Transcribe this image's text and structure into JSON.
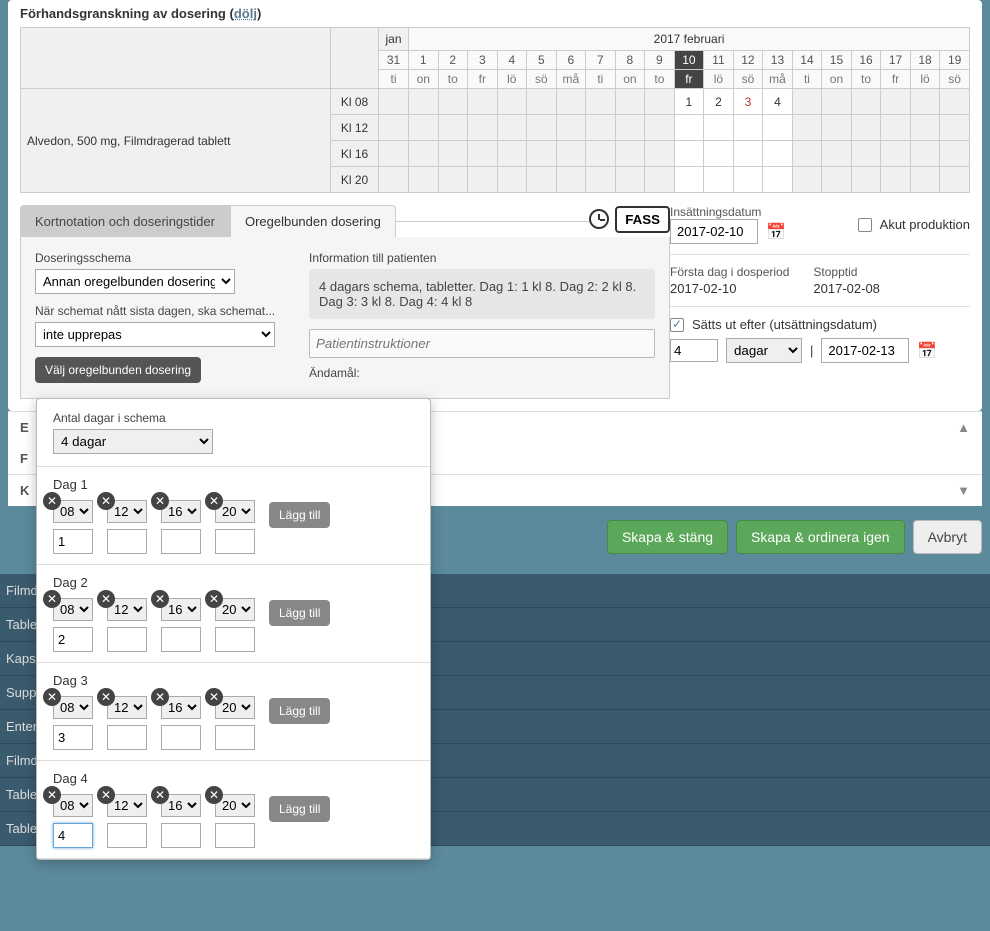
{
  "preview": {
    "title": "Förhandsgranskning av dosering",
    "hide": "dölj"
  },
  "calendar": {
    "jan": "jan",
    "month": "2017 februari",
    "days": [
      "31",
      "1",
      "2",
      "3",
      "4",
      "5",
      "6",
      "7",
      "8",
      "9",
      "10",
      "11",
      "12",
      "13",
      "14",
      "15",
      "16",
      "17",
      "18",
      "19"
    ],
    "wk": [
      "ti",
      "on",
      "to",
      "fr",
      "lö",
      "sö",
      "må",
      "ti",
      "on",
      "to",
      "fr",
      "lö",
      "sö",
      "må",
      "ti",
      "on",
      "to",
      "fr",
      "lö",
      "sö"
    ],
    "today_index": 10,
    "med": "Alvedon, 500 mg, Filmdragerad tablett",
    "times": [
      "Kl 08",
      "Kl 12",
      "Kl 16",
      "Kl 20"
    ],
    "doses08": [
      "1",
      "2",
      "3",
      "4"
    ]
  },
  "tabs": {
    "left": "Kortnotation och doseringstider",
    "right": "Oregelbunden dosering",
    "fass": "FASS"
  },
  "dos": {
    "schema_label": "Doseringsschema",
    "schema_value": "Annan oregelbunden dosering",
    "repeat_label": "När schemat nått sista dagen, ska schemat...",
    "repeat_value": "inte upprepas",
    "choose_btn": "Välj oregelbunden dosering"
  },
  "info": {
    "title": "Information till patienten",
    "text": "4 dagars schema, tabletter. Dag 1: 1 kl 8. Dag 2: 2 kl 8. Dag 3: 3 kl 8. Dag 4: 4 kl 8",
    "placeholder": "Patientinstruktioner",
    "purpose": "Ändamål:"
  },
  "dates": {
    "insat_label": "Insättningsdatum",
    "insat_value": "2017-02-10",
    "akut": "Akut produktion",
    "first_label": "Första dag i dosperiod",
    "first_value": "2017-02-10",
    "stop_label": "Stopptid",
    "stop_value": "2017-02-08",
    "out_label": "Sätts ut efter (utsättningsdatum)",
    "out_qty": "4",
    "out_unit": "dagar",
    "out_date": "2017-02-13"
  },
  "buttons": {
    "save": "Skapa & stäng",
    "saveagain": "Skapa & ordinera igen",
    "cancel": "Avbryt"
  },
  "collapse": {
    "e": "E",
    "f": "F",
    "k": "K"
  },
  "bg_items": [
    "Filmd",
    "Table",
    "Kaps",
    "Supp",
    "Enter",
    "Filmd",
    "Table",
    "Table"
  ],
  "popover": {
    "days_label": "Antal dagar i schema",
    "days_value": "4 dagar",
    "add": "Lägg till",
    "days": [
      {
        "title": "Dag 1",
        "qty": [
          "1",
          "",
          "",
          ""
        ]
      },
      {
        "title": "Dag 2",
        "qty": [
          "2",
          "",
          "",
          ""
        ]
      },
      {
        "title": "Dag 3",
        "qty": [
          "3",
          "",
          "",
          ""
        ]
      },
      {
        "title": "Dag 4",
        "qty": [
          "4",
          "",
          "",
          ""
        ]
      }
    ],
    "times": [
      "08",
      "12",
      "16",
      "20"
    ]
  }
}
